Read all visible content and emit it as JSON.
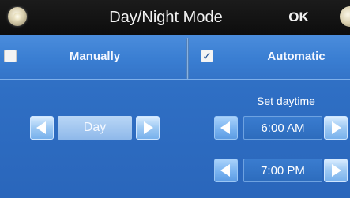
{
  "header": {
    "title": "Day/Night Mode",
    "ok_label": "OK",
    "home_icon": "home-circle-icon",
    "extra_icon": "settings-circle-icon"
  },
  "mode": {
    "manual": {
      "label": "Manually",
      "checked": false
    },
    "automatic": {
      "label": "Automatic",
      "checked": true,
      "check_glyph": "✓"
    }
  },
  "manual_selector": {
    "value": "Day",
    "prev_icon": "arrow-left-icon",
    "next_icon": "arrow-right-icon"
  },
  "daytime": {
    "label": "Set daytime",
    "start": "6:00 AM",
    "end": "7:00 PM"
  },
  "colors": {
    "title_bar": "#111111",
    "panel_blue": "#2f6fc4",
    "mode_row_blue": "#3a7ed2",
    "arrow_button": "#9cc8f3"
  }
}
